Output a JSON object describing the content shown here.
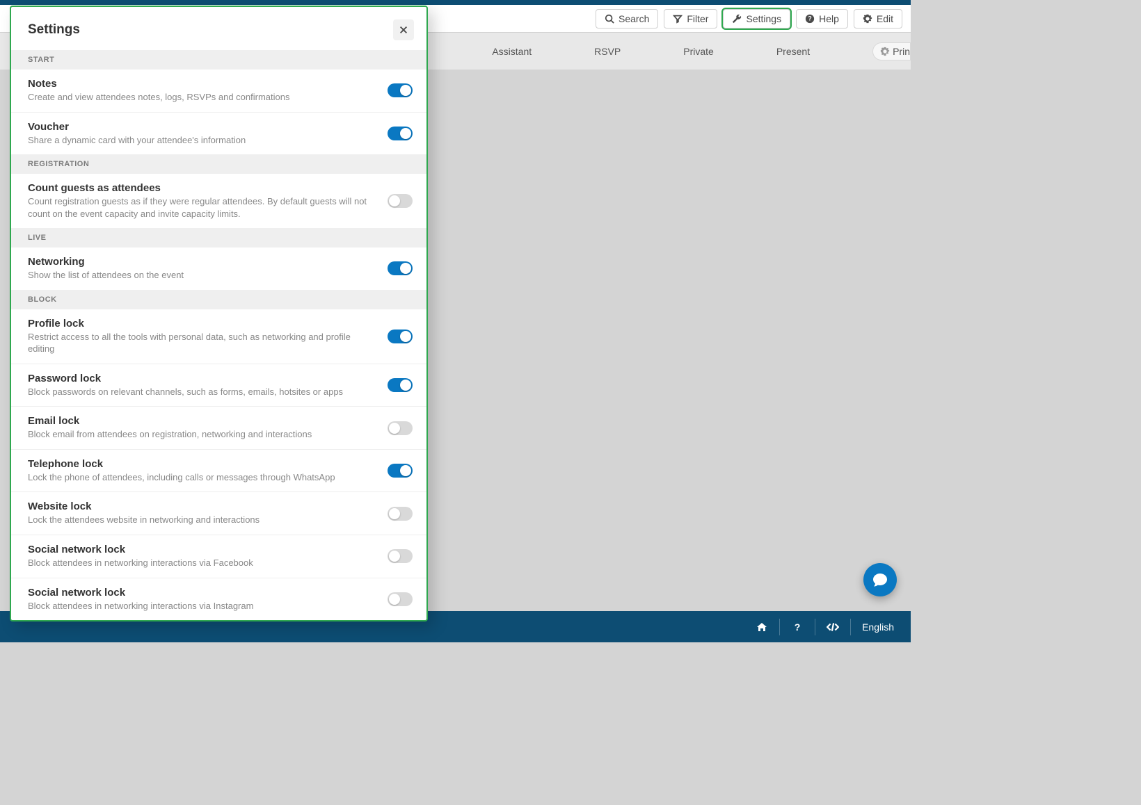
{
  "toolbar": {
    "search": "Search",
    "filter": "Filter",
    "settings": "Settings",
    "help": "Help",
    "edit": "Edit"
  },
  "columns": {
    "assistant": "Assistant",
    "rsvp": "RSVP",
    "private": "Private",
    "present": "Present",
    "print": "Prin"
  },
  "footer": {
    "language": "English"
  },
  "modal": {
    "title": "Settings",
    "groups": [
      {
        "label": "START",
        "items": [
          {
            "title": "Notes",
            "desc": "Create and view attendees notes, logs, RSVPs and confirmations",
            "on": true
          },
          {
            "title": "Voucher",
            "desc": "Share a dynamic card with your attendee's information",
            "on": true
          }
        ]
      },
      {
        "label": "REGISTRATION",
        "items": [
          {
            "title": "Count guests as attendees",
            "desc": "Count registration guests as if they were regular attendees. By default guests will not count on the event capacity and invite capacity limits.",
            "on": false
          }
        ]
      },
      {
        "label": "LIVE",
        "items": [
          {
            "title": "Networking",
            "desc": "Show the list of attendees on the event",
            "on": true
          }
        ]
      },
      {
        "label": "BLOCK",
        "items": [
          {
            "title": "Profile lock",
            "desc": "Restrict access to all the tools with personal data, such as networking and profile editing",
            "on": true
          },
          {
            "title": "Password lock",
            "desc": "Block passwords on relevant channels, such as forms, emails, hotsites or apps",
            "on": true
          },
          {
            "title": "Email lock",
            "desc": "Block email from attendees on registration, networking and interactions",
            "on": false
          },
          {
            "title": "Telephone lock",
            "desc": "Lock the phone of attendees, including calls or messages through WhatsApp",
            "on": true
          },
          {
            "title": "Website lock",
            "desc": "Lock the attendees website in networking and interactions",
            "on": false
          },
          {
            "title": "Social network lock",
            "desc": "Block attendees in networking interactions via Facebook",
            "on": false
          },
          {
            "title": "Social network lock",
            "desc": "Block attendees in networking interactions via Instagram",
            "on": false
          }
        ]
      }
    ]
  }
}
